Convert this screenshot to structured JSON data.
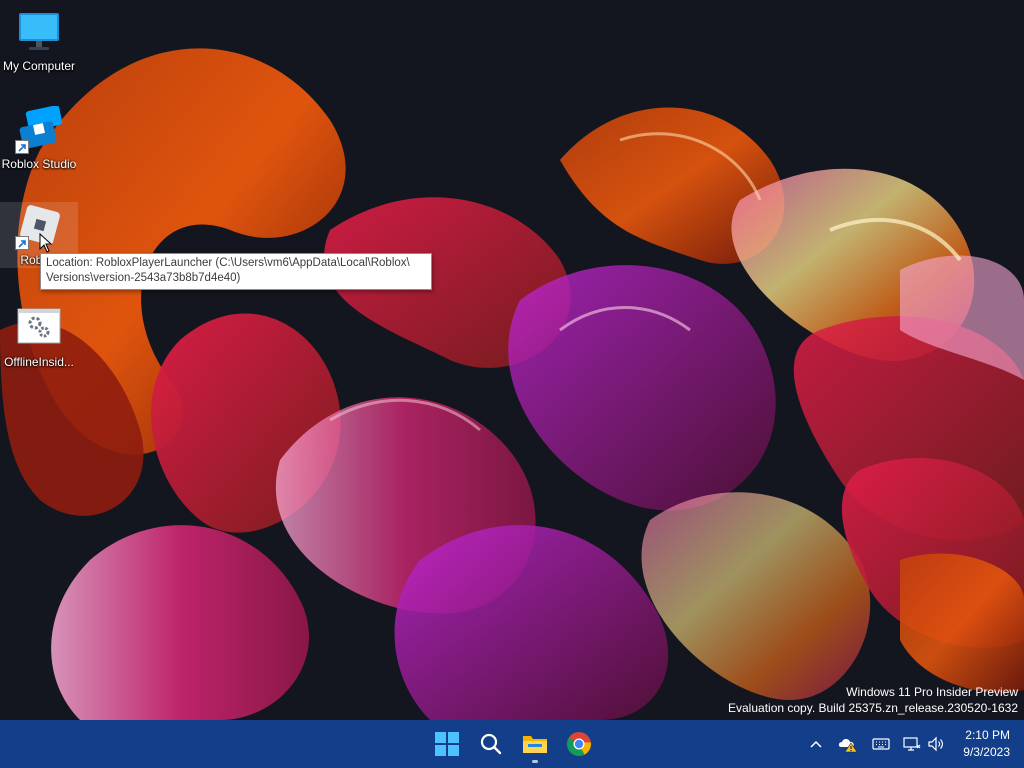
{
  "desktop": {
    "icons": [
      {
        "label": "My Computer",
        "icon": "monitor-icon"
      },
      {
        "label": "Roblox Studio",
        "icon": "roblox-studio-icon"
      },
      {
        "label": "Roblox",
        "icon": "roblox-player-icon"
      },
      {
        "label": "OfflineInsid...",
        "icon": "settings-window-icon"
      }
    ]
  },
  "tooltip": {
    "line1": "Location: RobloxPlayerLauncher (C:\\Users\\vm6\\AppData\\Local\\Roblox\\",
    "line2": "Versions\\version-2543a73b8b7d4e40)"
  },
  "watermark": {
    "line1": "Windows 11 Pro Insider Preview",
    "line2": "Evaluation copy. Build 25375.zn_release.230520-1632"
  },
  "taskbar": {
    "background": "#123e8a",
    "apps": [
      "start-icon",
      "search-icon",
      "file-explorer-icon",
      "chrome-icon"
    ]
  },
  "clock": {
    "time": "2:10 PM",
    "date": "9/3/2023"
  }
}
